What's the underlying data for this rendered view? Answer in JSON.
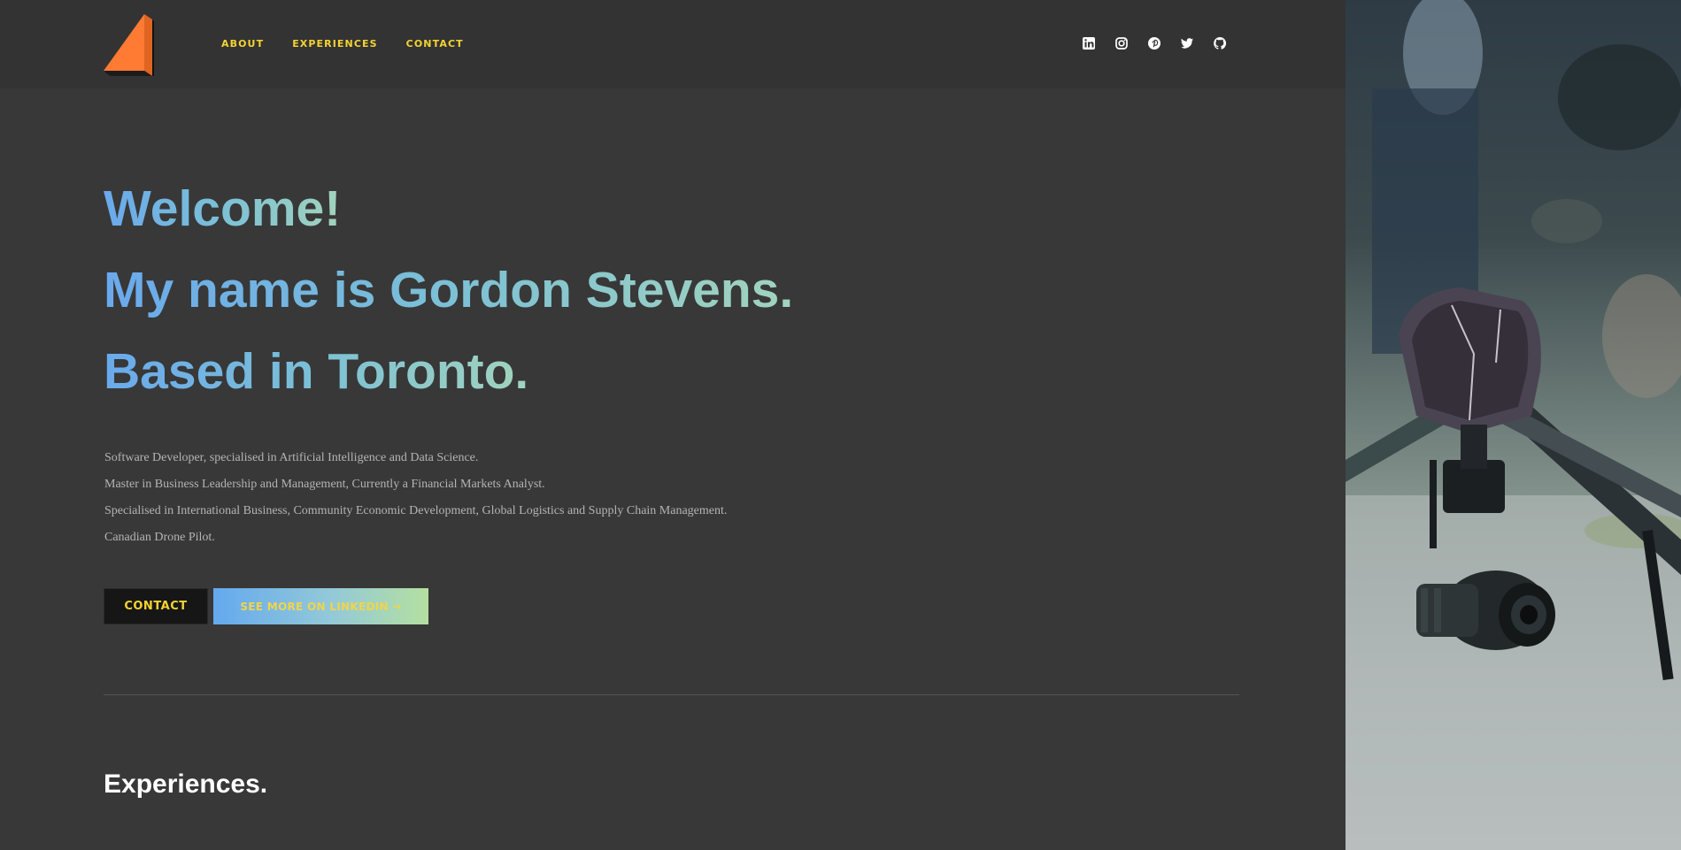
{
  "nav": {
    "items": [
      {
        "label": "ABOUT"
      },
      {
        "label": "EXPERIENCES"
      },
      {
        "label": "CONTACT"
      }
    ]
  },
  "social": {
    "icons": [
      "linkedin-icon",
      "instagram-icon",
      "pinterest-icon",
      "twitter-icon",
      "github-icon"
    ]
  },
  "hero": {
    "line1": "Welcome!",
    "line2": "My name is Gordon Stevens.",
    "line3": "Based in Toronto."
  },
  "description": {
    "lines": [
      "Software Developer, specialised in Artificial Intelligence and Data Science.",
      "Master in Business Leadership and Management, Currently a Financial Markets Analyst.",
      "Specialised in International Business, Community Economic Development, Global Logistics and Supply Chain Management.",
      "Canadian Drone Pilot."
    ]
  },
  "buttons": {
    "contact_label": "CONTACT",
    "linkedin_label": "SEE MORE ON LINKEDIN →"
  },
  "experiences": {
    "title": "Experiences."
  },
  "colors": {
    "accent_yellow": "#f5d332",
    "gradient_start": "#6aa9ec",
    "gradient_end": "#a2d4bd",
    "background": "#383838",
    "logo_orange": "#ff7a33"
  }
}
